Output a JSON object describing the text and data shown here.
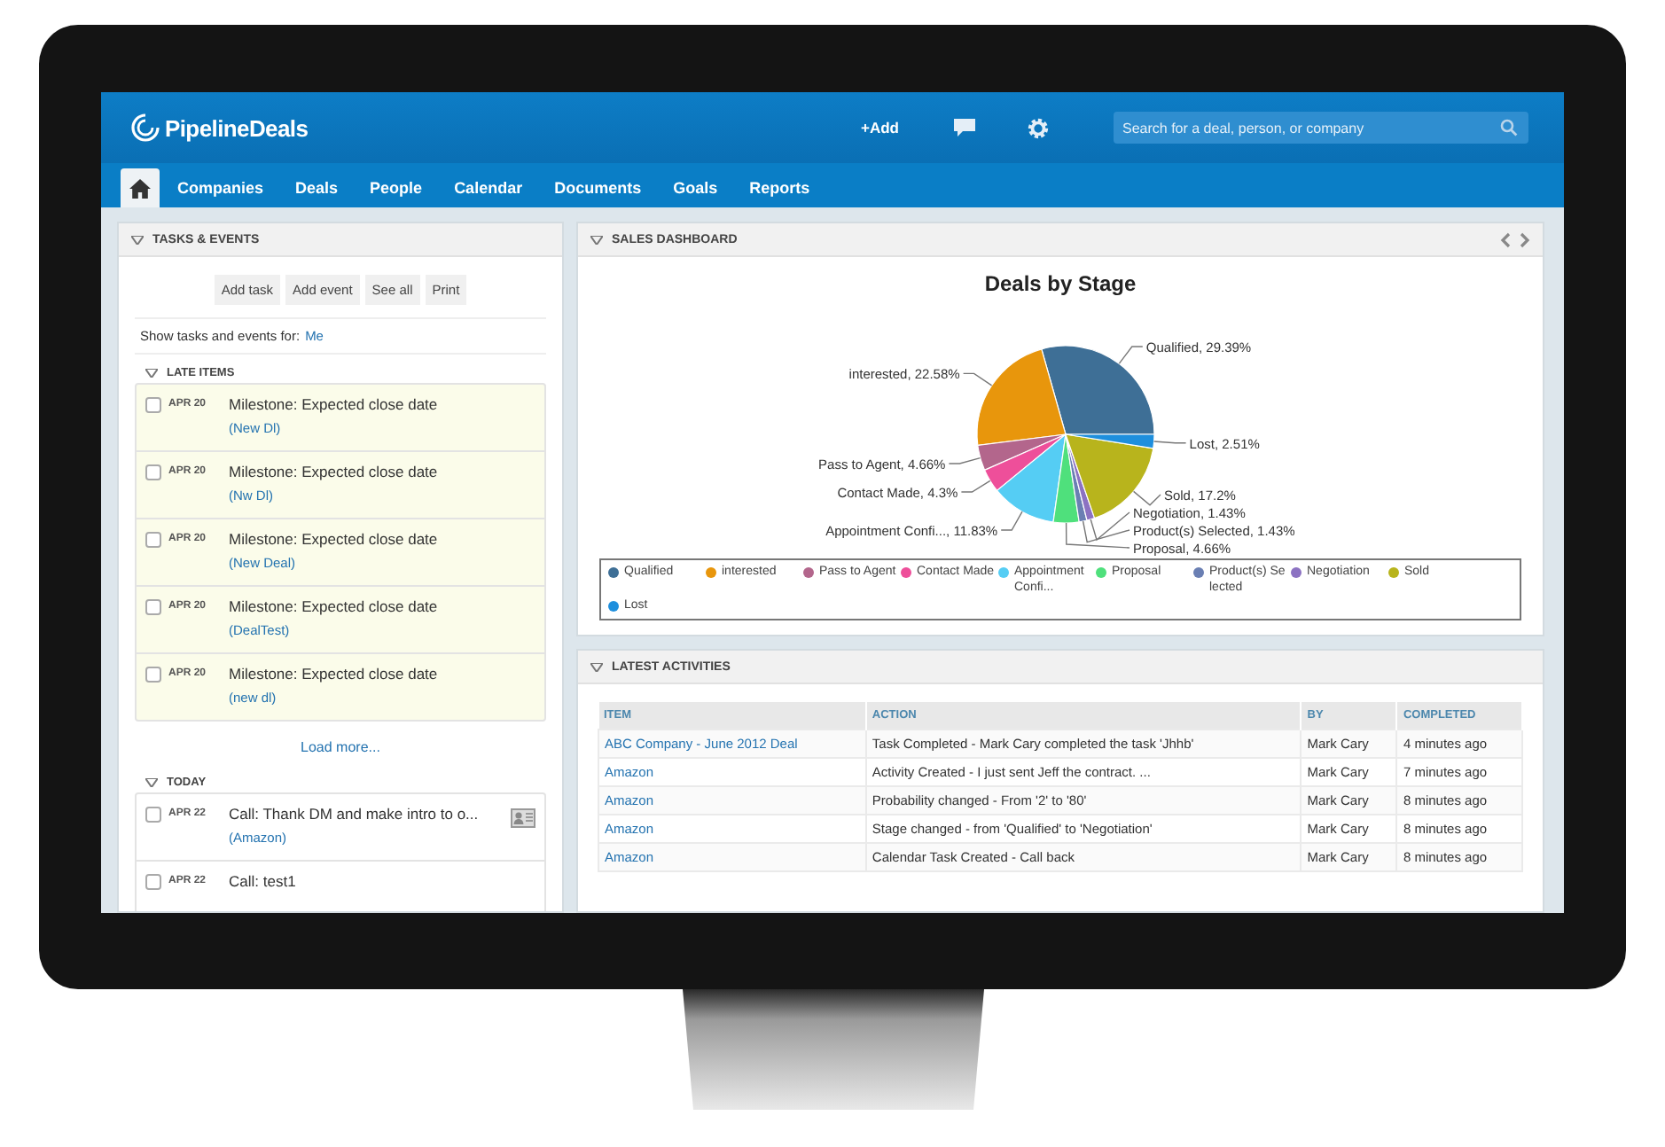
{
  "app": {
    "logo": "PipelineDeals",
    "add": "+Add",
    "search": {
      "placeholder": "Search for a deal, person, or company"
    }
  },
  "nav": [
    {
      "kind": "home",
      "selected": true
    },
    {
      "kind": "text",
      "label": "Companies",
      "selected": false
    },
    {
      "kind": "text",
      "label": "Deals",
      "selected": false
    },
    {
      "kind": "text",
      "label": "People",
      "selected": false
    },
    {
      "kind": "text",
      "label": "Calendar",
      "selected": false
    },
    {
      "kind": "text",
      "label": "Documents",
      "selected": false
    },
    {
      "kind": "text",
      "label": "Goals",
      "selected": false
    },
    {
      "kind": "text",
      "label": "Reports",
      "selected": false
    }
  ],
  "tasks": {
    "title": "TASKS & EVENTS",
    "buttons": [
      "Add task",
      "Add event",
      "See all",
      "Print"
    ],
    "filter_label": "Show tasks and events for:",
    "filter_value": "Me",
    "sections": [
      {
        "title": "LATE ITEMS",
        "overdue": true,
        "load_more": "Load more...",
        "items": [
          {
            "date": "APR 20",
            "title": "Milestone: Expected close date",
            "link": "(New Dl)",
            "checked": false,
            "contact_card": false
          },
          {
            "date": "APR 20",
            "title": "Milestone: Expected close date",
            "link": "(Nw Dl)",
            "checked": false,
            "contact_card": false
          },
          {
            "date": "APR 20",
            "title": "Milestone: Expected close date",
            "link": "(New Deal)",
            "checked": false,
            "contact_card": false
          },
          {
            "date": "APR 20",
            "title": "Milestone: Expected close date",
            "link": "(DealTest)",
            "checked": false,
            "contact_card": false
          },
          {
            "date": "APR 20",
            "title": "Milestone: Expected close date",
            "link": "(new dl)",
            "checked": false,
            "contact_card": false
          }
        ]
      },
      {
        "title": "TODAY",
        "overdue": false,
        "items": [
          {
            "date": "APR 22",
            "title": "Call: Thank DM and make intro to o...",
            "link": "(Amazon)",
            "checked": false,
            "contact_card": true
          },
          {
            "date": "APR 22",
            "title": "Call: test1",
            "checked": false,
            "contact_card": false
          }
        ]
      }
    ]
  },
  "dashboard": {
    "title": "SALES DASHBOARD",
    "chart_data": {
      "type": "pie",
      "title": "Deals by Stage",
      "categories": [
        "Qualified",
        "interested",
        "Pass to Agent",
        "Contact Made",
        "Appointment Confi...",
        "Proposal",
        "Product(s) Selected",
        "Negotiation",
        "Sold",
        "Lost"
      ],
      "legend": "bottom",
      "series": [
        {
          "values": [
            29.39,
            22.58,
            4.66,
            4.3,
            11.83,
            4.66,
            1.43,
            1.43,
            17.2,
            2.51
          ]
        }
      ],
      "colors": [
        "#3e6f96",
        "#e8960c",
        "#b3668c",
        "#ee4f9a",
        "#55cdf4",
        "#4fe07c",
        "#6a7fb3",
        "#8c72c2",
        "#b8b41c",
        "#1e8fdd"
      ],
      "value_labels": [
        "Qualified, 29.39%",
        "interested, 22.58%",
        "Pass to Agent, 4.66%",
        "Contact Made, 4.3%",
        "Appointment Confi..., 11.83%",
        "Proposal, 4.66%",
        "Product(s) Selected, 1.43%",
        "Negotiation, 1.43%",
        "Sold, 17.2%",
        "Lost, 2.51%"
      ]
    }
  },
  "activities": {
    "title": "LATEST ACTIVITIES",
    "columns": [
      "ITEM",
      "ACTION",
      "BY",
      "COMPLETED"
    ],
    "rows": [
      [
        "ABC Company - June 2012 Deal",
        "Task Completed - Mark Cary completed the task 'Jhhb'",
        "Mark Cary",
        "4 minutes ago"
      ],
      [
        "Amazon",
        "Activity Created - I just sent Jeff the contract. ...",
        "Mark Cary",
        "7 minutes ago"
      ],
      [
        "Amazon",
        "Probability changed - From '2' to '80'",
        "Mark Cary",
        "8 minutes ago"
      ],
      [
        "Amazon",
        "Stage changed - from 'Qualified' to 'Negotiation'",
        "Mark Cary",
        "8 minutes ago"
      ],
      [
        "Amazon",
        "Calendar Task Created - Call back",
        "Mark Cary",
        "8 minutes ago"
      ]
    ]
  }
}
